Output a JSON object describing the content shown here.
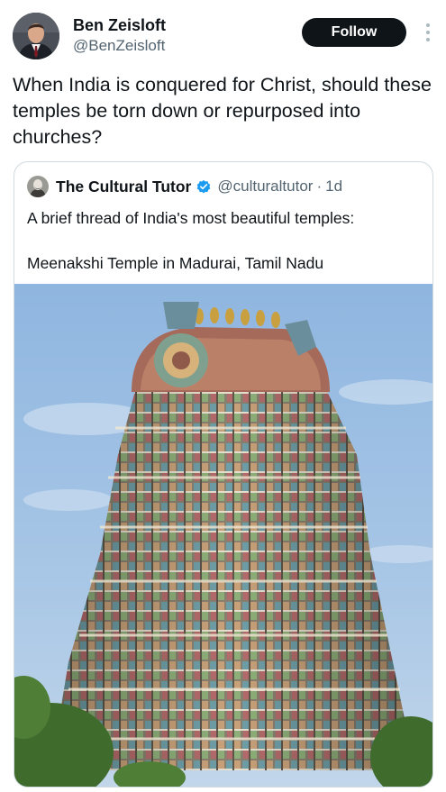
{
  "post": {
    "author_name": "Ben Zeisloft",
    "author_handle": "@BenZeisloft",
    "follow_label": "Follow",
    "text": "When India is conquered for Christ, should these temples be torn down or repurposed into churches?"
  },
  "quote": {
    "author_name": "The Cultural Tutor",
    "author_handle": "@culturaltutor",
    "separator": "·",
    "time": "1d",
    "line1": "A brief thread of India's most beautiful temples:",
    "line2": "Meenakshi Temple in Madurai, Tamil Nadu"
  },
  "icons": {
    "more": "more-vertical-icon",
    "verified": "verified-badge-icon"
  },
  "colors": {
    "follow_bg": "#0f1419",
    "verified": "#1d9bf0",
    "secondary_text": "#536471"
  }
}
